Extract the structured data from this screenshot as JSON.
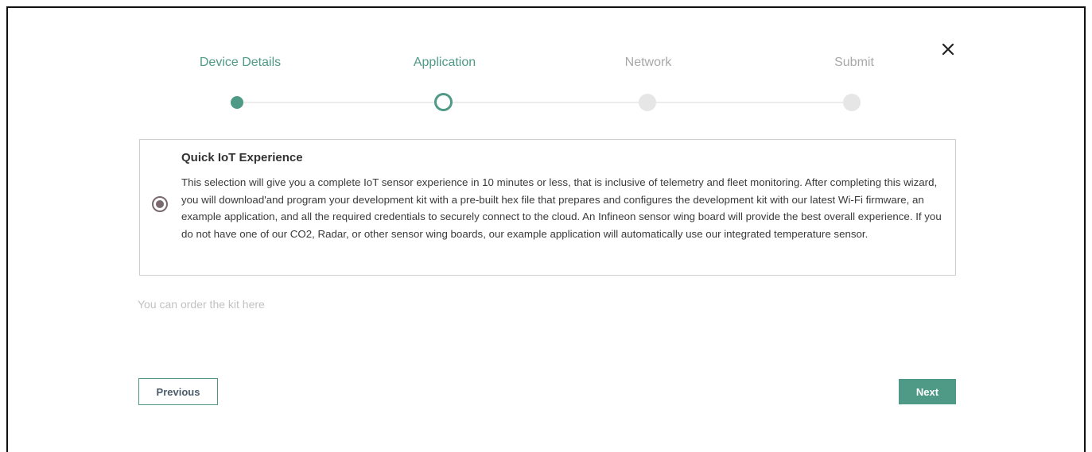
{
  "wizard": {
    "steps": [
      {
        "label": "Device Details",
        "state": "done"
      },
      {
        "label": "Application",
        "state": "active"
      },
      {
        "label": "Network",
        "state": "pending"
      },
      {
        "label": "Submit",
        "state": "pending"
      }
    ],
    "close_icon": "close-icon"
  },
  "option": {
    "selected": true,
    "title": "Quick IoT Experience",
    "description": "This selection will give you a complete IoT sensor experience in 10 minutes or less, that is inclusive of telemetry and fleet monitoring. After completing this wizard, you will download'and program your development kit with a pre-built hex file that prepares and configures the development kit with our latest Wi-Fi firmware, an example application, and all the required credentials to securely connect to the cloud. An Infineon sensor wing board will provide the best overall experience. If you do not have one of our CO2, Radar, or other sensor wing boards, our example application will automatically use our integrated temperature sensor."
  },
  "order_link": "You can order the kit here",
  "buttons": {
    "previous_label": "Previous",
    "next_label": "Next"
  },
  "colors": {
    "accent": "#4e9a86",
    "pending": "#e6e6e6",
    "radio": "#7a6a6f"
  }
}
